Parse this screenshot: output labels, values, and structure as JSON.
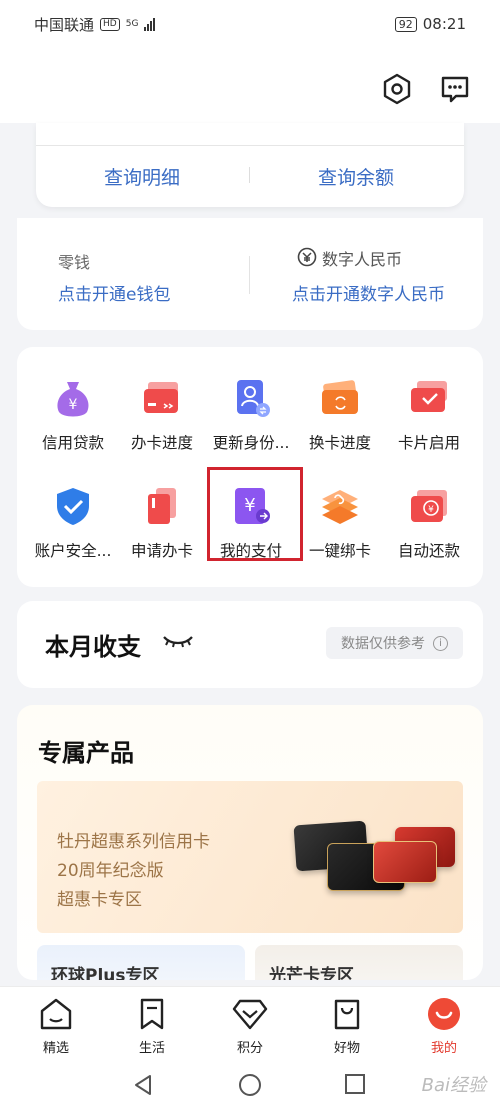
{
  "status_bar": {
    "carrier": "中国联通",
    "network_badge": "HD",
    "network_type": "5G",
    "battery": "92",
    "time": "08:21"
  },
  "header": {
    "settings_icon": "settings-hexagon-icon",
    "message_icon": "message-bubble-icon"
  },
  "account_card": {
    "detail_link": "查询明细",
    "balance_link": "查询余额"
  },
  "wallet_card": {
    "change_label": "零钱",
    "change_link": "点击开通e钱包",
    "ecny_label": "数字人民币",
    "ecny_link": "点击开通数字人民币"
  },
  "services": [
    {
      "label": "信用贷款",
      "icon": "money-bag-icon",
      "color": "#a46be8"
    },
    {
      "label": "办卡进度",
      "icon": "card-progress-icon",
      "color": "#ef4b4b"
    },
    {
      "label": "更新身份...",
      "icon": "id-update-icon",
      "color": "#5b72f0"
    },
    {
      "label": "换卡进度",
      "icon": "card-exchange-icon",
      "color": "#f47a2a"
    },
    {
      "label": "卡片启用",
      "icon": "card-activate-icon",
      "color": "#ef4b4b"
    },
    {
      "label": "账户安全...",
      "icon": "shield-check-icon",
      "color": "#2f7de8"
    },
    {
      "label": "申请办卡",
      "icon": "card-apply-icon",
      "color": "#ef4b4b"
    },
    {
      "label": "我的支付",
      "icon": "payment-yuan-icon",
      "color": "#8c56f0"
    },
    {
      "label": "一键绑卡",
      "icon": "link-cards-icon",
      "color": "#f47a2a"
    },
    {
      "label": "自动还款",
      "icon": "auto-repay-icon",
      "color": "#ef4b4b"
    }
  ],
  "monthly": {
    "title": "本月收支",
    "notice": "数据仅供参考"
  },
  "products": {
    "title": "专属产品",
    "banner_lines": [
      "牡丹超惠系列信用卡",
      "20周年纪念版",
      "超惠卡专区"
    ],
    "sub_left": "环球Plus专区",
    "sub_right": "光芒卡专区"
  },
  "tabs": [
    {
      "label": "精选",
      "icon": "home-icon"
    },
    {
      "label": "生活",
      "icon": "bookmark-icon"
    },
    {
      "label": "积分",
      "icon": "diamond-icon"
    },
    {
      "label": "好物",
      "icon": "shopping-bag-icon"
    },
    {
      "label": "我的",
      "icon": "profile-smile-icon"
    }
  ],
  "watermark": "Bai经验"
}
